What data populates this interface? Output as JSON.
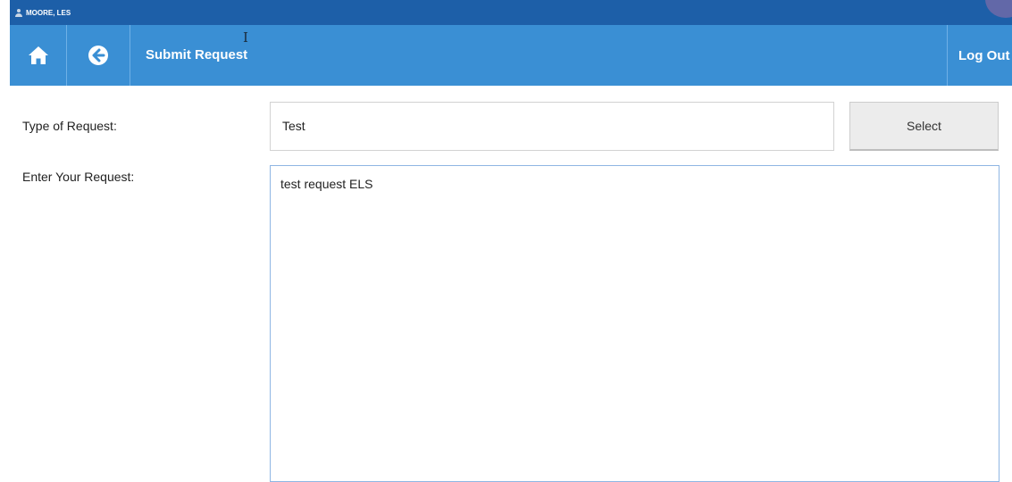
{
  "user": {
    "name": "MOORE, LES"
  },
  "navbar": {
    "title": "Submit Request",
    "logout_label": "Log Out"
  },
  "form": {
    "type_label": "Type of Request:",
    "type_value": "Test",
    "select_label": "Select",
    "request_label": "Enter Your Request:",
    "request_value": "test request ELS"
  },
  "colors": {
    "userbar": "#1d5fa8",
    "navbar": "#3a8fd4",
    "select_button": "#ececec"
  },
  "icons": {
    "user": "user-icon",
    "home": "home-icon",
    "back": "back-arrow-circle-icon",
    "cursor": "text-cursor-icon"
  }
}
